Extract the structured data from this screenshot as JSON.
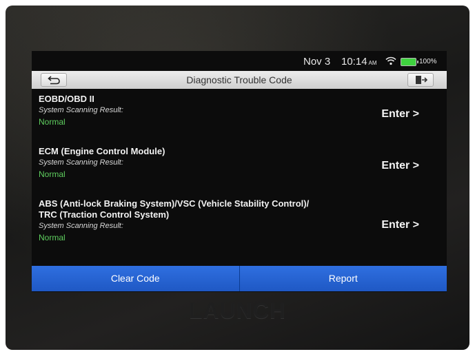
{
  "status": {
    "date": "Nov 3",
    "time": "10:14",
    "ampm": "AM",
    "battery": "100%"
  },
  "header": {
    "title": "Diagnostic Trouble Code"
  },
  "items": [
    {
      "title_lines": [
        "EOBD/OBD II"
      ],
      "subtitle": "System Scanning Result:",
      "status": "Normal",
      "action": "Enter >"
    },
    {
      "title_lines": [
        "ECM (Engine Control Module)"
      ],
      "subtitle": "System Scanning Result:",
      "status": "Normal",
      "action": "Enter >"
    },
    {
      "title_lines": [
        "ABS (Anti-lock Braking System)/VSC (Vehicle Stability Control)/",
        "TRC (Traction Control System)"
      ],
      "subtitle": "System Scanning Result:",
      "status": "Normal",
      "action": "Enter >"
    }
  ],
  "buttons": {
    "clear_code": "Clear Code",
    "report": "Report"
  },
  "brand": "LAUNCH",
  "colors": {
    "accent_blue": "#2a66d8",
    "status_green": "#5fcf5f",
    "battery_green": "#3fd23f"
  },
  "icons": {
    "back": "back-arrow-icon",
    "exit": "exit-icon",
    "wifi": "wifi-icon",
    "battery": "battery-icon"
  }
}
